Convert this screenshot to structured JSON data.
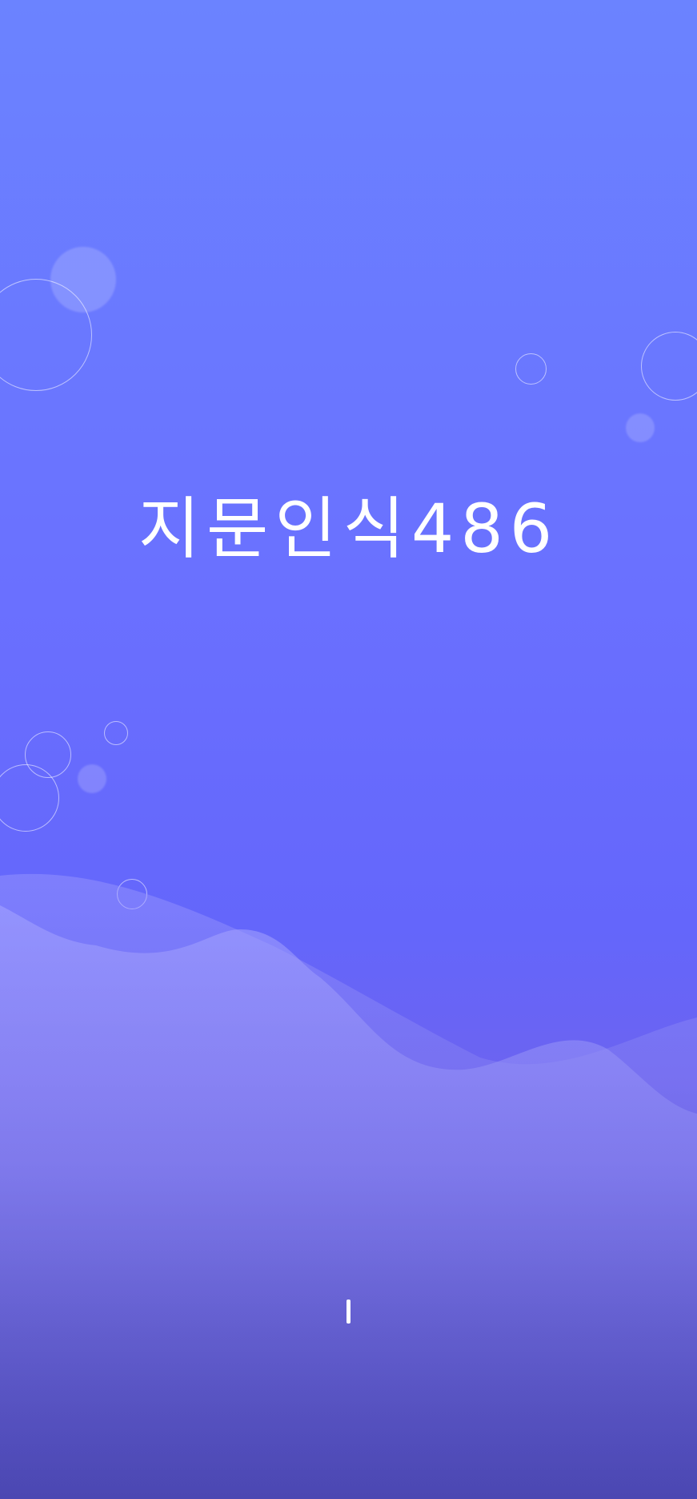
{
  "app": {
    "title": "지문인식486"
  },
  "colors": {
    "background_top": "#6b83ff",
    "background_middle": "#6466fb",
    "background_bottom": "#4b47b2",
    "title_text": "#ffffff"
  },
  "loading_indicator": {
    "state": "loading"
  }
}
